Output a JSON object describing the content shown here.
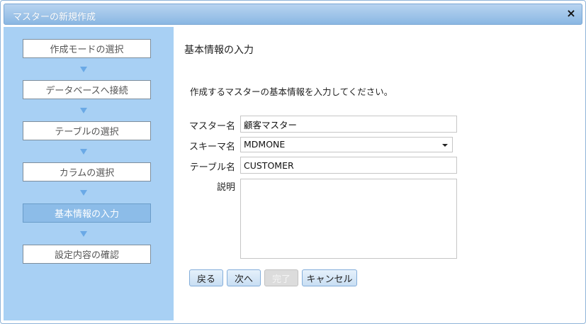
{
  "dialog": {
    "title": "マスターの新規作成",
    "close_icon": "×"
  },
  "steps": [
    {
      "label": "作成モードの選択",
      "active": false
    },
    {
      "label": "データベースへ接続",
      "active": false
    },
    {
      "label": "テーブルの選択",
      "active": false
    },
    {
      "label": "カラムの選択",
      "active": false
    },
    {
      "label": "基本情報の入力",
      "active": true
    },
    {
      "label": "設定内容の確認",
      "active": false
    }
  ],
  "content": {
    "section_title": "基本情報の入力",
    "instruction": "作成するマスターの基本情報を入力してください。",
    "fields": {
      "master_name": {
        "label": "マスター名",
        "value": "顧客マスター"
      },
      "schema_name": {
        "label": "スキーマ名",
        "value": "MDMONE"
      },
      "table_name": {
        "label": "テーブル名",
        "value": "CUSTOMER"
      },
      "description": {
        "label": "説明",
        "value": ""
      }
    }
  },
  "buttons": {
    "back": "戻る",
    "next": "次へ",
    "finish": "完了",
    "cancel": "キャンセル"
  },
  "colors": {
    "sidebar_bg": "#a8d0f4",
    "active_step": "#8cbce8",
    "titlebar": "#8ab7e3"
  }
}
